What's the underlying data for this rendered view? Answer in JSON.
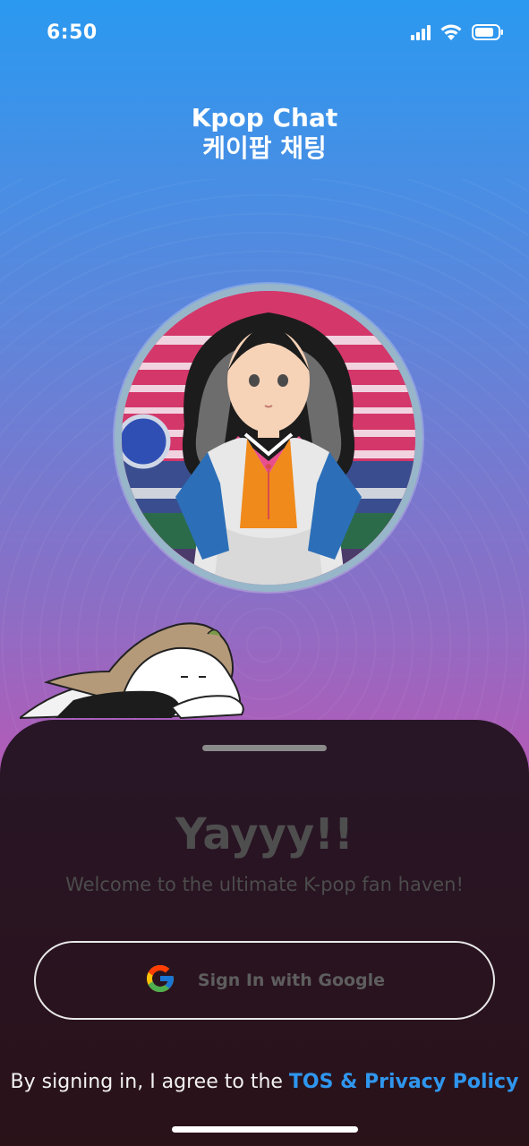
{
  "status_bar": {
    "time": "6:50",
    "icons": [
      "signal-icon",
      "wifi-icon",
      "battery-icon"
    ]
  },
  "app": {
    "title_en": "Kpop Chat",
    "title_ko": "케이팝 채팅"
  },
  "images": {
    "avatar": "illustrated girl in hanbok over Korean flag background",
    "mascot": "sleeping character lying down"
  },
  "sheet": {
    "headline": "Yayyy!!",
    "subtitle": "Welcome to the ultimate K-pop fan haven!",
    "google_button_label": "Sign In with Google",
    "terms_prefix": "By signing in, I agree to the ",
    "terms_link": "TOS & Privacy Policy"
  },
  "colors": {
    "gradient_top": "#2b99f0",
    "gradient_bottom": "#b55ab2",
    "sheet_bg": "#281627",
    "link": "#2f96ee"
  }
}
